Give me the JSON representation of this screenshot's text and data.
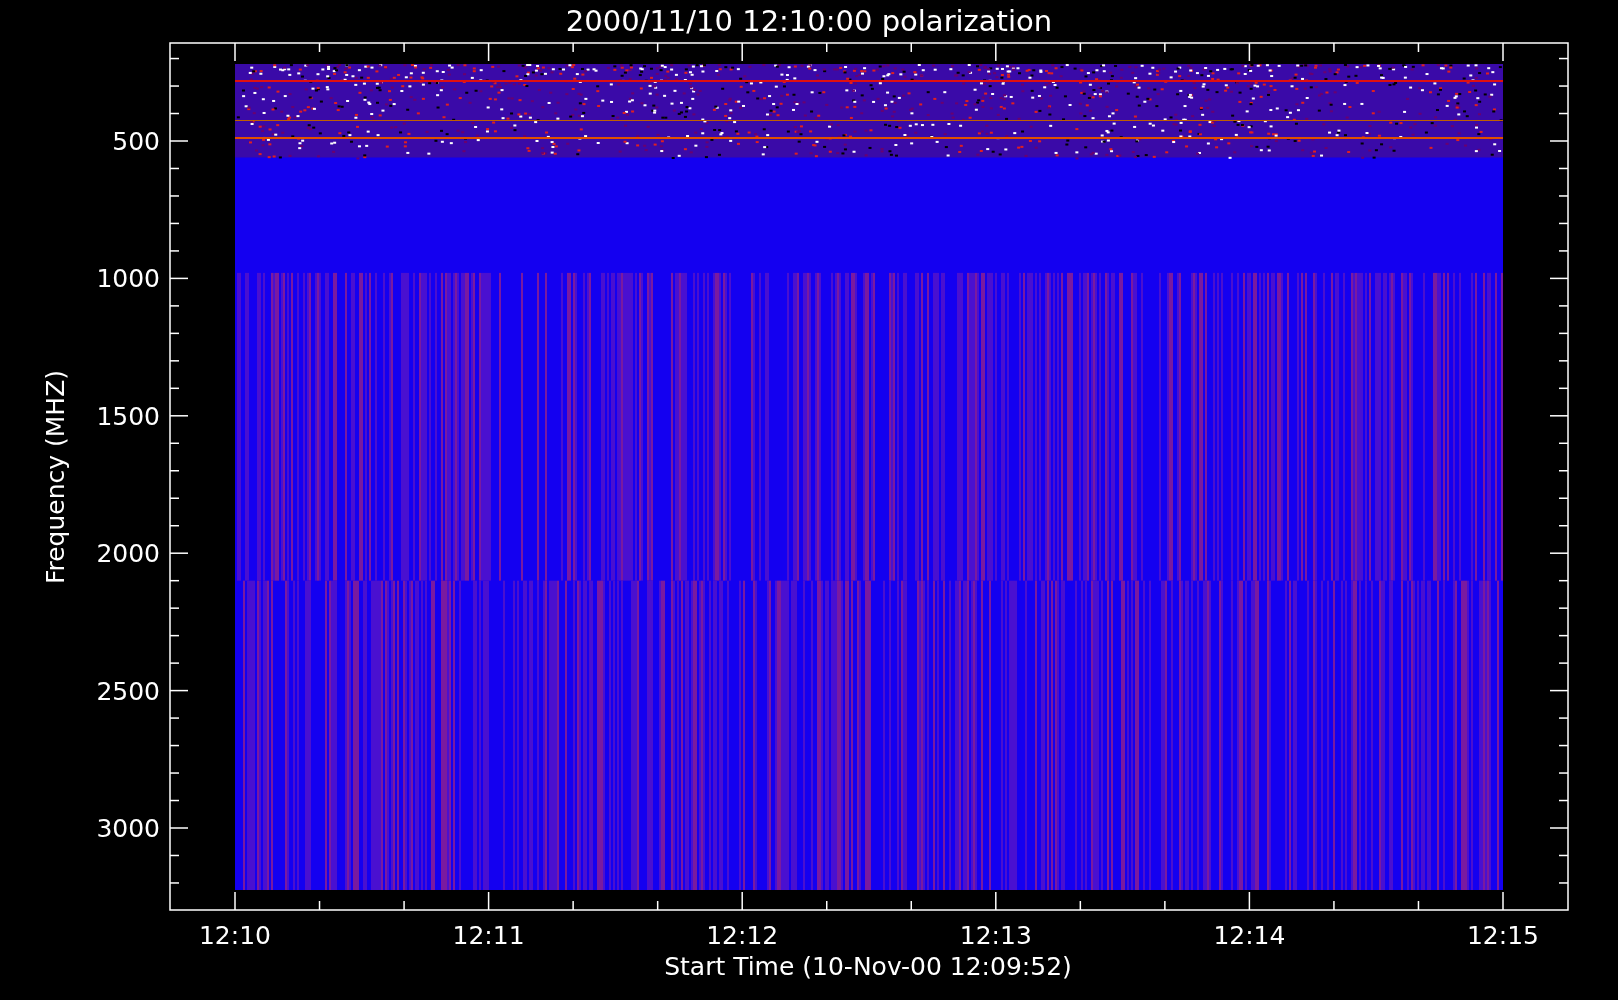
{
  "plot": {
    "title": "2000/11/10 12:10:00 polarization",
    "xlabel": "Start Time (10-Nov-00 12:09:52)",
    "ylabel": "Frequency (MHZ)",
    "xtick_labels": [
      "12:10",
      "12:11",
      "12:12",
      "12:13",
      "12:14",
      "12:15"
    ],
    "ytick_labels": [
      "500",
      "1000",
      "1500",
      "2000",
      "2500",
      "3000"
    ]
  }
}
